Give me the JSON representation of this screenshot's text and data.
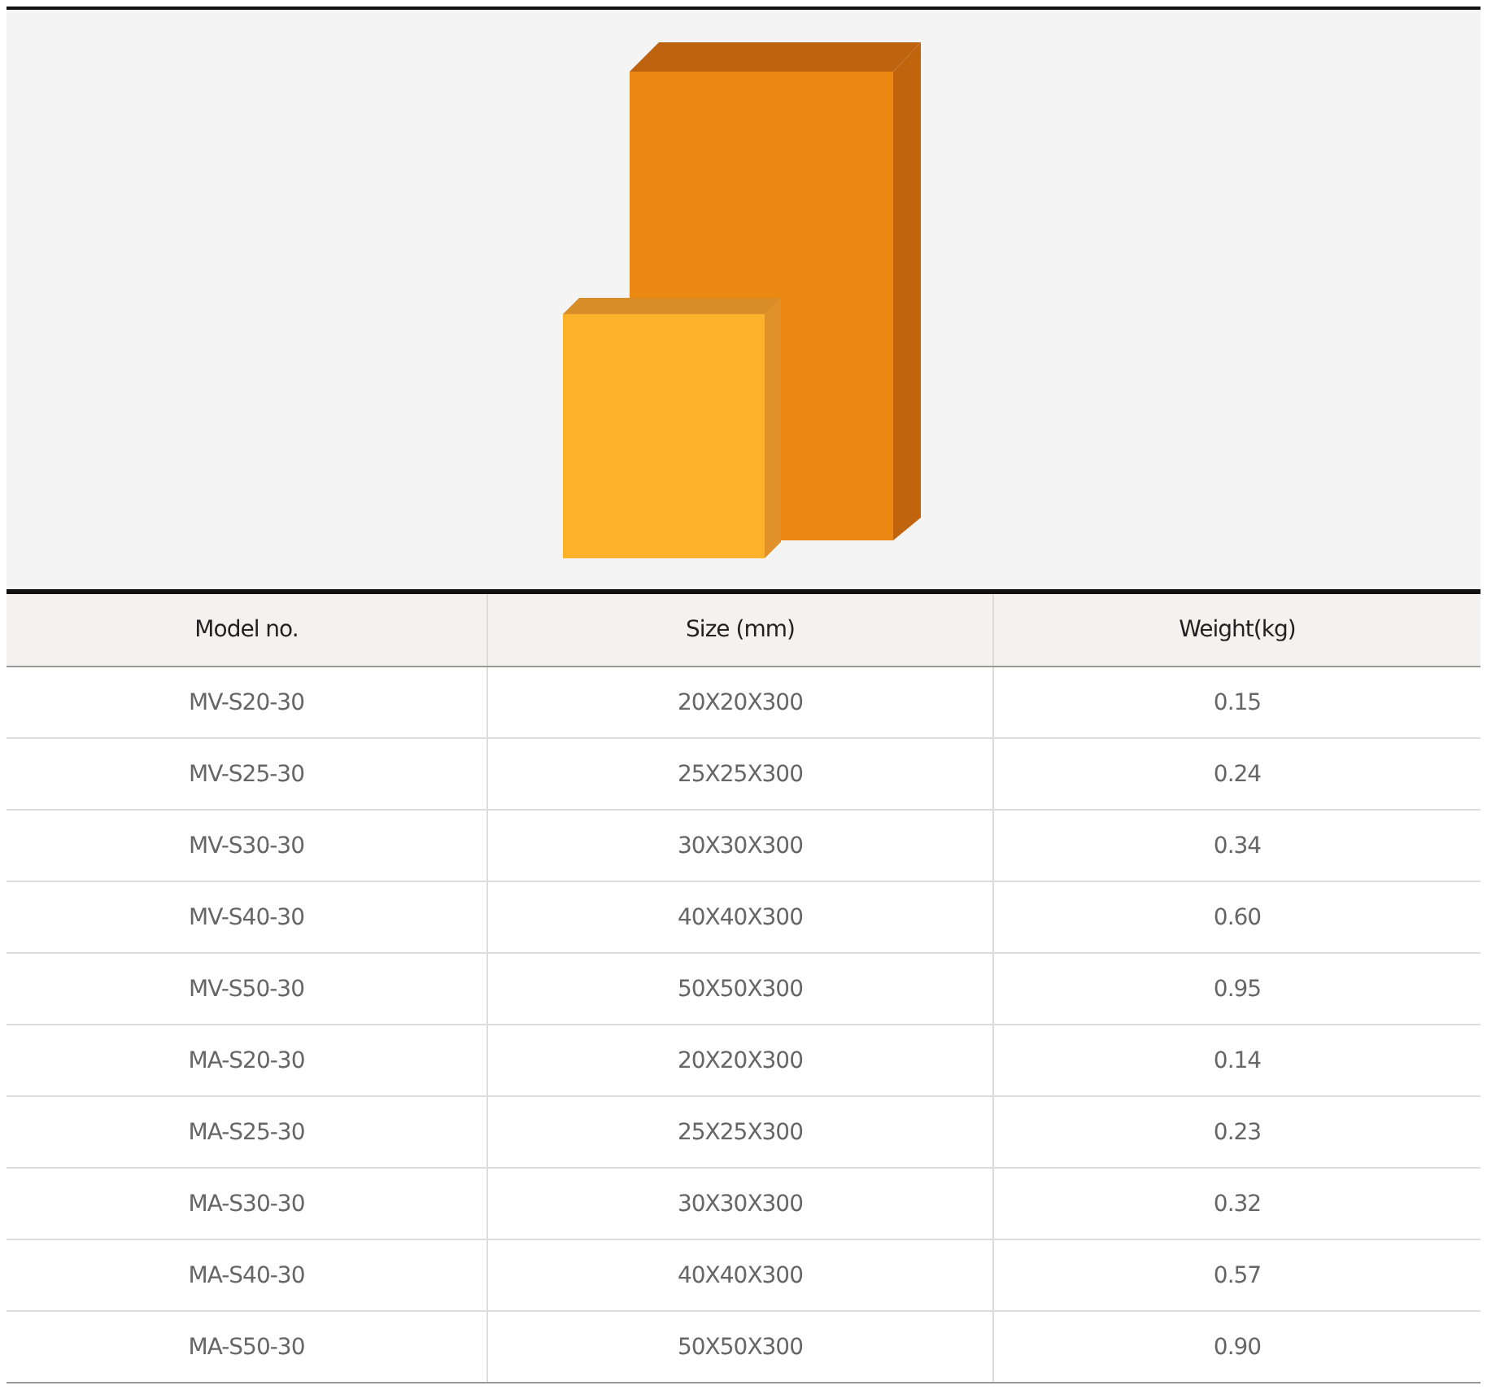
{
  "table": {
    "columns": [
      "Model no.",
      "Size (mm)",
      "Weight(kg)"
    ],
    "rows": [
      [
        "MV-S20-30",
        "20X20X300",
        "0.15"
      ],
      [
        "MV-S25-30",
        "25X25X300",
        "0.24"
      ],
      [
        "MV-S30-30",
        "30X30X300",
        "0.34"
      ],
      [
        "MV-S40-30",
        "40X40X300",
        "0.60"
      ],
      [
        "MV-S50-30",
        "50X50X300",
        "0.95"
      ],
      [
        "MA-S20-30",
        "20X20X300",
        "0.14"
      ],
      [
        "MA-S25-30",
        "25X25X300",
        "0.23"
      ],
      [
        "MA-S30-30",
        "30X30X300",
        "0.32"
      ],
      [
        "MA-S40-30",
        "40X40X300",
        "0.57"
      ],
      [
        "MA-S50-30",
        "50X50X300",
        "0.90"
      ]
    ]
  }
}
